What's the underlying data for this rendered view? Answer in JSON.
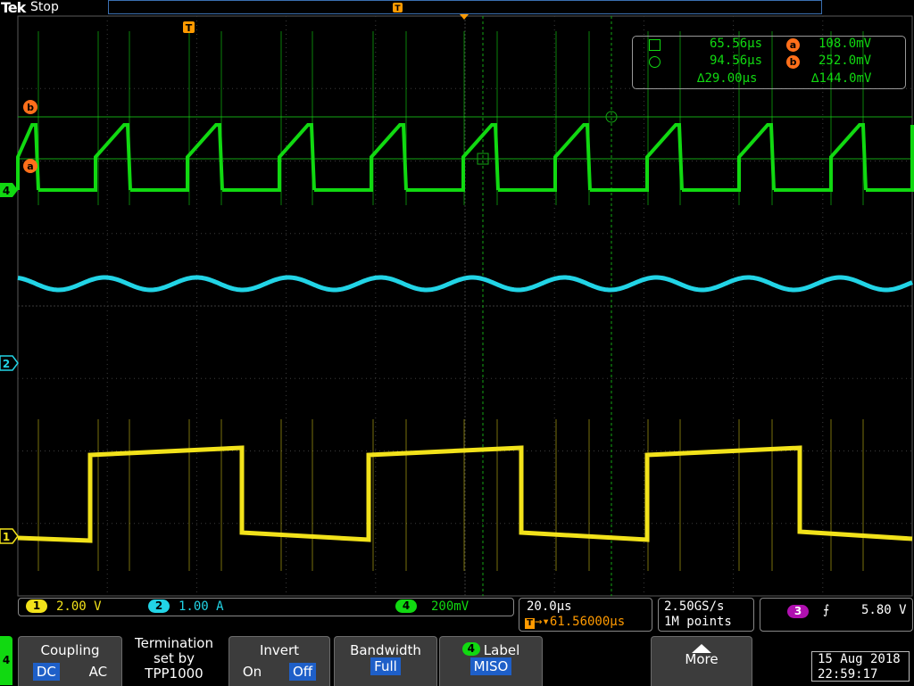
{
  "header": {
    "logo": "Tek",
    "run_state": "Stop"
  },
  "markers": {
    "trigger": "T",
    "cursor_b": "b",
    "cursor_a": "a",
    "ch4": "4",
    "ch2": "2",
    "ch1": "1"
  },
  "cursor_readout": {
    "t1": "65.56µs",
    "t2": "94.56µs",
    "dt": "29.00µs",
    "va_label": "a",
    "va": "108.0mV",
    "vb_label": "b",
    "vb": "252.0mV",
    "dv": "144.0mV"
  },
  "channels": [
    {
      "num": "1",
      "scale": "2.00 V",
      "color": "#f2e21a"
    },
    {
      "num": "2",
      "scale": "1.00 A",
      "color": "#22d4e6"
    },
    {
      "num": "4",
      "scale": "200mV",
      "color": "#11d911"
    }
  ],
  "horizontal": {
    "scale": "20.0µs",
    "position": "61.56000µs"
  },
  "acquisition": {
    "rate": "2.50GS/s",
    "record": "1M points"
  },
  "trigger": {
    "source": "3",
    "level": "5.80 V",
    "source_color": "#b010b0"
  },
  "softkeys": {
    "side_channel": "4",
    "coupling": {
      "title": "Coupling",
      "dc": "DC",
      "ac": "AC"
    },
    "termination": {
      "line1": "Termination",
      "line2": "set by",
      "line3": "TPP1000"
    },
    "invert": {
      "title": "Invert",
      "on": "On",
      "off": "Off"
    },
    "bandwidth": {
      "title": "Bandwidth",
      "value": "Full"
    },
    "label": {
      "ch": "4",
      "title": "Label",
      "value": "MISO"
    },
    "more": {
      "title": "More"
    }
  },
  "datetime": {
    "date": "15 Aug 2018",
    "time": "22:59:17"
  },
  "colors": {
    "grid": "#5a5a5a",
    "cursor": "#13a613",
    "trigger": "#ff9a00",
    "ch4": "#11d911",
    "ch2": "#22d4e6",
    "ch1": "#f2e21a"
  }
}
